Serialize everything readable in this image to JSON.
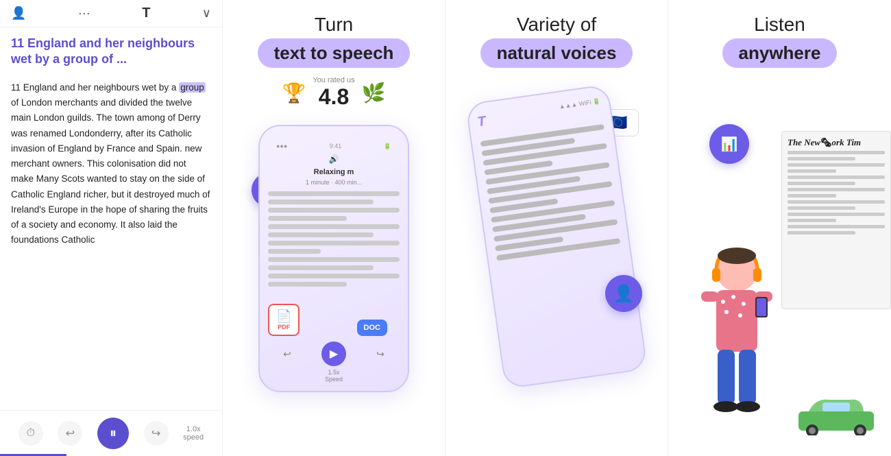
{
  "panels": {
    "reading": {
      "title": "11 England and her neighbours wet by a group of ...",
      "header_icons": [
        "person",
        "ellipsis",
        "T",
        "checkmark"
      ],
      "content": "11 England and her neighbours wet by a group of London merchants and divided the twelve main London guilds. The town among of Derry was renamed Londonderry, after its Catholic invasion of England by France and Spain. new merchant owners. This colonisation did not make Many Scots wanted to stay on the side of Catholic England richer, but it destroyed much of Ireland's Europe in the hope of sharing the fruits of a society and economy. It also laid the foundations Catholic",
      "highlight_word": "group",
      "footer": {
        "speed": "1.0x",
        "speed_sub": "speed"
      }
    },
    "tts": {
      "title_line1": "Turn",
      "title_pill": "text to speech",
      "rating_label": "You rated us",
      "rating_value": "4.8",
      "phone": {
        "time": "9:41",
        "doc_title": "Relaxing m",
        "doc_sub": "1 minute · 400 min...",
        "speed_label": "1.5x",
        "speed_sublabel": "Speed"
      }
    },
    "voices": {
      "title_line1": "Variety of",
      "title_pill": "natural voices",
      "flag_emoji": "🇪🇺"
    },
    "listen": {
      "title_line1": "Listen",
      "title_pill": "anywhere",
      "newspaper": {
        "title": "The New York Times"
      }
    }
  }
}
